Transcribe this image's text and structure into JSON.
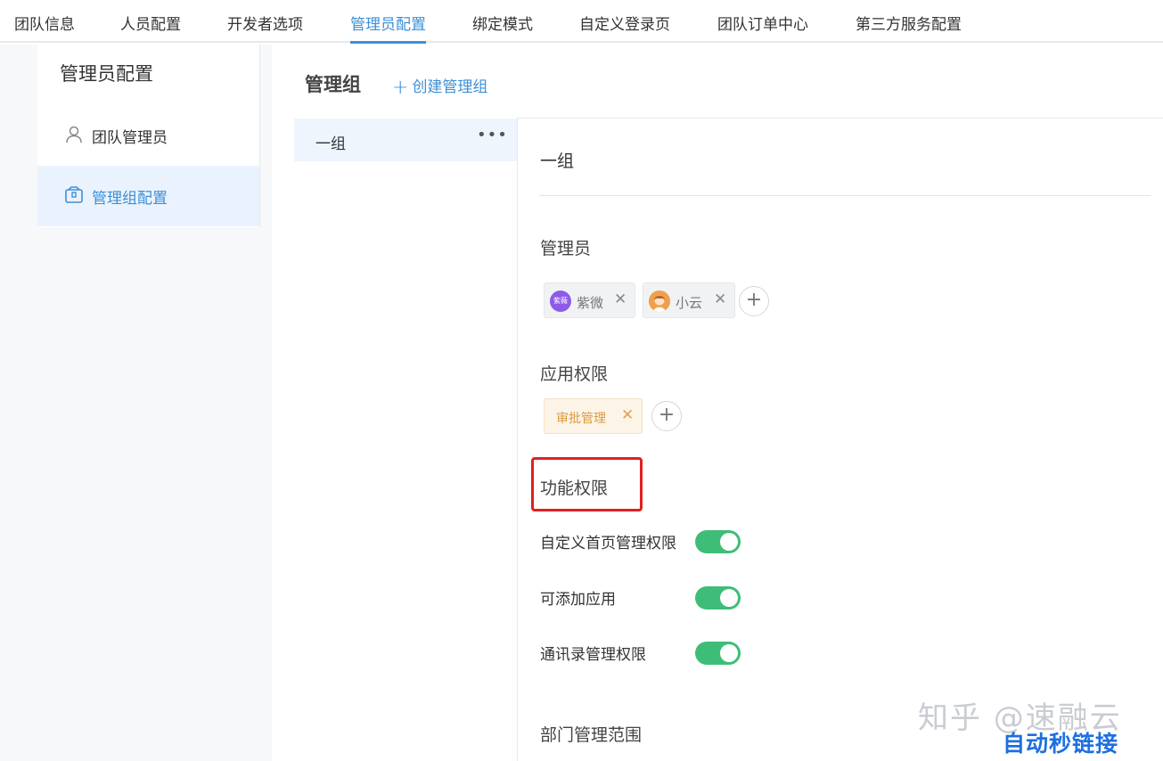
{
  "topnav": {
    "tabs": [
      {
        "label": "团队信息"
      },
      {
        "label": "人员配置"
      },
      {
        "label": "开发者选项"
      },
      {
        "label": "管理员配置"
      },
      {
        "label": "绑定模式"
      },
      {
        "label": "自定义登录页"
      },
      {
        "label": "团队订单中心"
      },
      {
        "label": "第三方服务配置"
      }
    ],
    "active_tab": "管理员配置"
  },
  "sidebar": {
    "title": "管理员配置",
    "items": [
      {
        "label": "团队管理员",
        "icon": "user-icon"
      },
      {
        "label": "管理组配置",
        "icon": "group-box-icon",
        "active": true
      }
    ]
  },
  "main": {
    "title": "管理组",
    "create_label": "创建管理组",
    "groups": [
      {
        "name": "一组",
        "more": "•••"
      }
    ]
  },
  "detail": {
    "group_name": "一组",
    "admins_label": "管理员",
    "admins": [
      {
        "name": "紫微",
        "avatar_text": "紫薇"
      },
      {
        "name": "小云"
      }
    ],
    "app_perm_label": "应用权限",
    "apps": [
      {
        "name": "审批管理"
      }
    ],
    "func_perm_label": "功能权限",
    "permissions": [
      {
        "label": "自定义首页管理权限",
        "enabled": true
      },
      {
        "label": "可添加应用",
        "enabled": true
      },
      {
        "label": "通讯录管理权限",
        "enabled": true
      }
    ],
    "dept_scope_label": "部门管理范围"
  },
  "colors": {
    "accent": "#3d8fd6",
    "toggle_on": "#3ebd78",
    "highlight": "#e02020",
    "app_tag_text": "#d99a3c"
  },
  "watermark": {
    "line1": "知乎 @速融云",
    "line2": "自动秒链接"
  }
}
